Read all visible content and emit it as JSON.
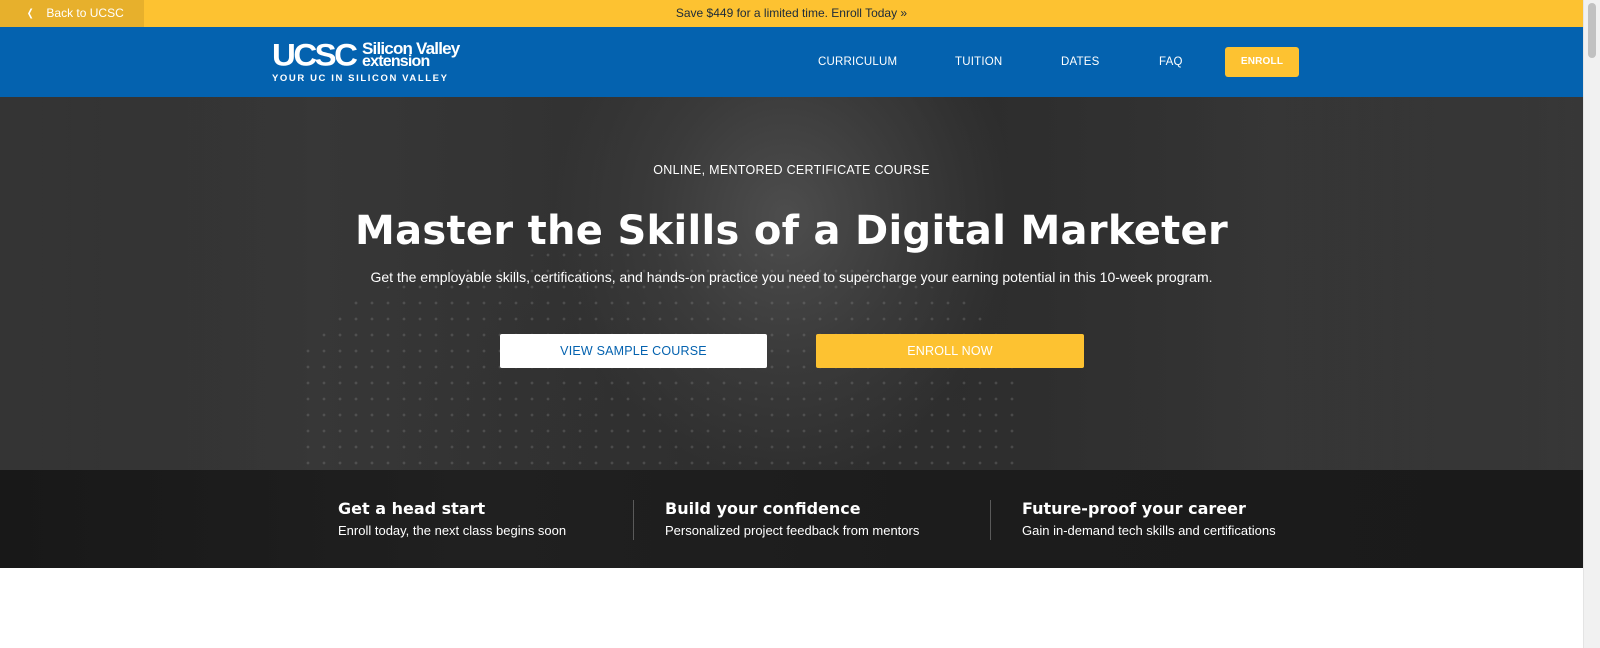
{
  "promo": {
    "back_label": "Back to UCSC",
    "back_icon": "chevron-left-icon",
    "offer_text": "Save $449 for a limited time. Enroll Today »"
  },
  "header": {
    "logo": {
      "wordmark": "UCSC",
      "line1": "Silicon Valley",
      "line2": "extension",
      "tagline": "YOUR UC IN SILICON VALLEY"
    },
    "nav": [
      "CURRICULUM",
      "TUITION",
      "DATES",
      "FAQ"
    ],
    "enroll_label": "ENROLL"
  },
  "hero": {
    "eyebrow": "ONLINE, MENTORED CERTIFICATE COURSE",
    "title": "Master the Skills of a Digital Marketer",
    "subtitle": "Get the employable skills, certifications, and hands-on practice you need to supercharge your earning potential in this 10-week program.",
    "sample_button": "VIEW SAMPLE COURSE",
    "enroll_button": "ENROLL NOW"
  },
  "features": [
    {
      "title": "Get a head start",
      "description": "Enroll today, the next class begins soon"
    },
    {
      "title": "Build your confidence",
      "description": "Personalized project feedback from mentors"
    },
    {
      "title": "Future-proof your career",
      "description": "Gain in-demand tech skills and certifications"
    }
  ],
  "colors": {
    "brand_blue": "#0462af",
    "brand_yellow": "#fdc231",
    "back_tab": "#e7b02c",
    "hero_dark": "#2c2c2c",
    "features_bg": "#1c1c1c"
  }
}
